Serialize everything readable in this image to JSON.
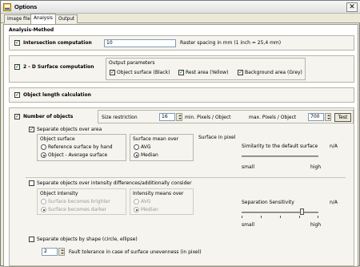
{
  "window": {
    "title": "Options",
    "close_label": "✕"
  },
  "tabs": [
    {
      "label": "Image files"
    },
    {
      "label": "Analysis"
    },
    {
      "label": "Output"
    }
  ],
  "section": {
    "label": "Analysis-Method"
  },
  "intersection": {
    "label": "Intersection computation",
    "checked": "✓",
    "value": "10",
    "raster_label": "Raster spacing in mm (1 inch = 25,4 mm)"
  },
  "surface2d": {
    "label": "2 - D Surface computation",
    "checked": "✓",
    "params_label": "Output parameters",
    "object_surface": "Object surface (Black)",
    "rest_area": "Rest area (Yellow)",
    "background_area": "Background area (Grey)"
  },
  "object_length": {
    "label": "Object length calculation",
    "checked": "✓"
  },
  "number_objects": {
    "label": "Number of objects",
    "checked": "✓",
    "size_restriction": "Size restriction",
    "min_value": "16",
    "min_label": "min. Pixels / Object",
    "max_value": "700",
    "max_label": "max. Pixels / Object",
    "test_label": "Test"
  },
  "separate_area": {
    "label": "Separate objects over area",
    "checked": "✓",
    "object_surface_label": "Object surface",
    "reference_by_hand": "Reference surface by hand",
    "object_average": "Object - Average surface",
    "surface_mean_over": "Surface mean over",
    "avg": "AVG",
    "median": "Median",
    "surface_in_pixel": "Surface in pixel",
    "similarity_label": "Similarity to the default surface",
    "similarity_value": "n/A",
    "small": "small",
    "high": "high"
  },
  "separate_intensity": {
    "label": "Separate objects over intensity differences/additionally consider",
    "object_intensity": "Object intensity",
    "brighter": "Surface becomes brighter",
    "darker": "Surface becomes darker",
    "intensity_mean_over": "Intensity means over",
    "avg": "AVG",
    "median": "Median",
    "sensitivity_label": "Separation Sensitivity",
    "sensitivity_value": "n/A",
    "sensitivity_level": 0.8,
    "small": "small",
    "high": "high"
  },
  "separate_shape": {
    "label": "Separate objects by shape (circle, ellipse)",
    "tolerance_value": "2",
    "tolerance_label": "Fault tolerance in case of surface unevenness (in pixel)"
  }
}
